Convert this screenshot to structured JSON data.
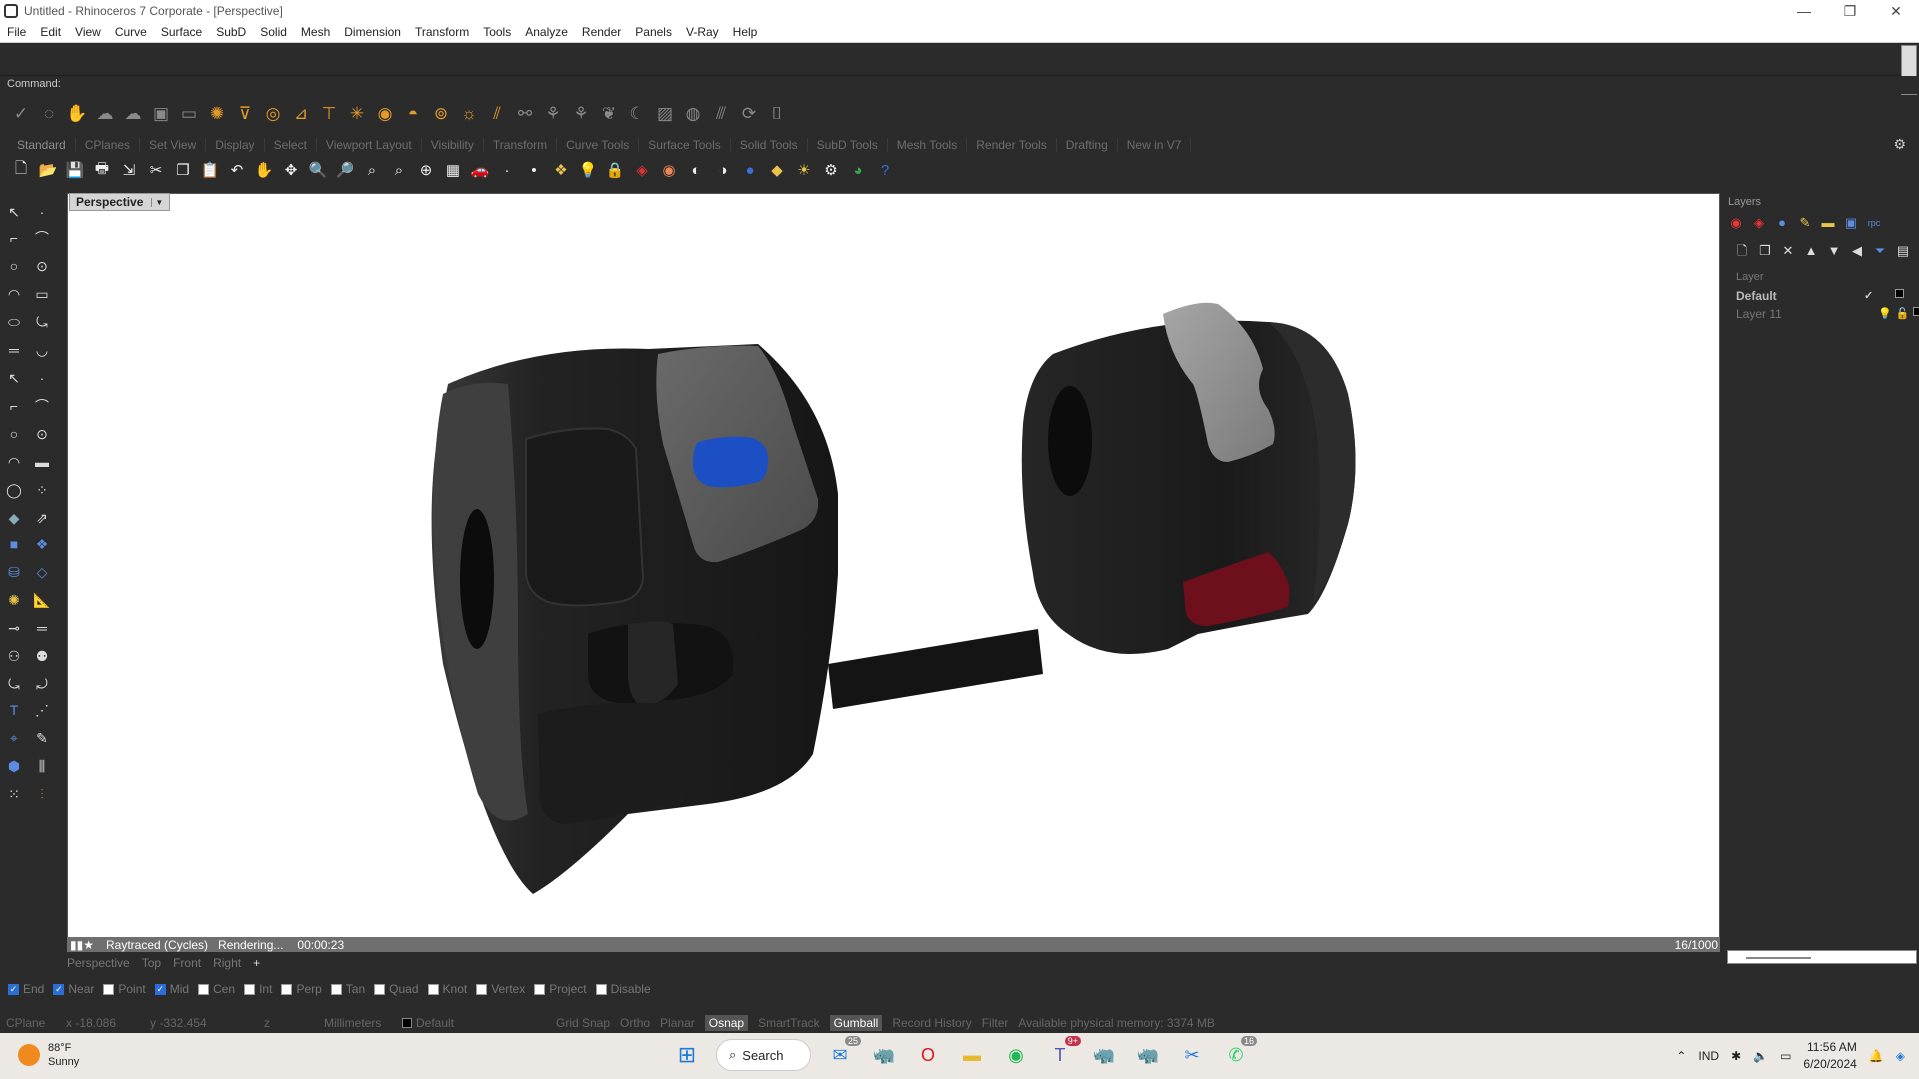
{
  "window": {
    "title": "Untitled - Rhinoceros 7 Corporate - [Perspective]",
    "controls": [
      "—",
      "❐",
      "✕"
    ]
  },
  "menu": [
    "File",
    "Edit",
    "View",
    "Curve",
    "Surface",
    "SubD",
    "Solid",
    "Mesh",
    "Dimension",
    "Transform",
    "Tools",
    "Analyze",
    "Render",
    "Panels",
    "V-Ray",
    "Help"
  ],
  "command": {
    "prompt": "Command:"
  },
  "toolbar_tabs": [
    "Standard",
    "CPlanes",
    "Set View",
    "Display",
    "Select",
    "Viewport Layout",
    "Visibility",
    "Transform",
    "Curve Tools",
    "Surface Tools",
    "Solid Tools",
    "SubD Tools",
    "Mesh Tools",
    "Render Tools",
    "Drafting",
    "New in V7"
  ],
  "viewport": {
    "label": "Perspective"
  },
  "render": {
    "mode": "Raytraced (Cycles)",
    "status": "Rendering...",
    "time": "00:00:23",
    "passes": "16/1000"
  },
  "viewport_tabs": [
    "Perspective",
    "Top",
    "Front",
    "Right",
    "+"
  ],
  "osnaps": [
    {
      "label": "End",
      "checked": true
    },
    {
      "label": "Near",
      "checked": true
    },
    {
      "label": "Point",
      "checked": false
    },
    {
      "label": "Mid",
      "checked": true
    },
    {
      "label": "Cen",
      "checked": false
    },
    {
      "label": "Int",
      "checked": false
    },
    {
      "label": "Perp",
      "checked": false
    },
    {
      "label": "Tan",
      "checked": false
    },
    {
      "label": "Quad",
      "checked": false
    },
    {
      "label": "Knot",
      "checked": false
    },
    {
      "label": "Vertex",
      "checked": false
    },
    {
      "label": "Project",
      "checked": false
    },
    {
      "label": "Disable",
      "checked": false
    }
  ],
  "status": {
    "cplane": "CPlane",
    "x": "x -18.086",
    "y": "y -332.454",
    "z": "z",
    "units": "Millimeters",
    "layer": "Default",
    "toggles": [
      "Grid Snap",
      "Ortho",
      "Planar",
      "Osnap",
      "SmartTrack",
      "Gumball",
      "Record History",
      "Filter"
    ],
    "memory": "Available physical memory: 3374 MB"
  },
  "layers": {
    "title": "Layers",
    "header": "Layer",
    "rows": [
      {
        "name": "Default",
        "current": true
      },
      {
        "name": "Layer 11",
        "current": false
      }
    ]
  },
  "taskbar": {
    "weather_temp": "88°F",
    "weather_desc": "Sunny",
    "search": "Search",
    "badges": {
      "mail": "25",
      "teams": "9+",
      "whatsapp": "16"
    },
    "lang": "IND",
    "time": "11:56 AM",
    "date": "6/20/2024"
  },
  "colors": {
    "accent": "#2a6ed6",
    "blue_button": "#1d4fc4",
    "red_button": "#6e0f1c",
    "body": "#1c1c1c",
    "grey_lever": "#8a8a8a"
  }
}
